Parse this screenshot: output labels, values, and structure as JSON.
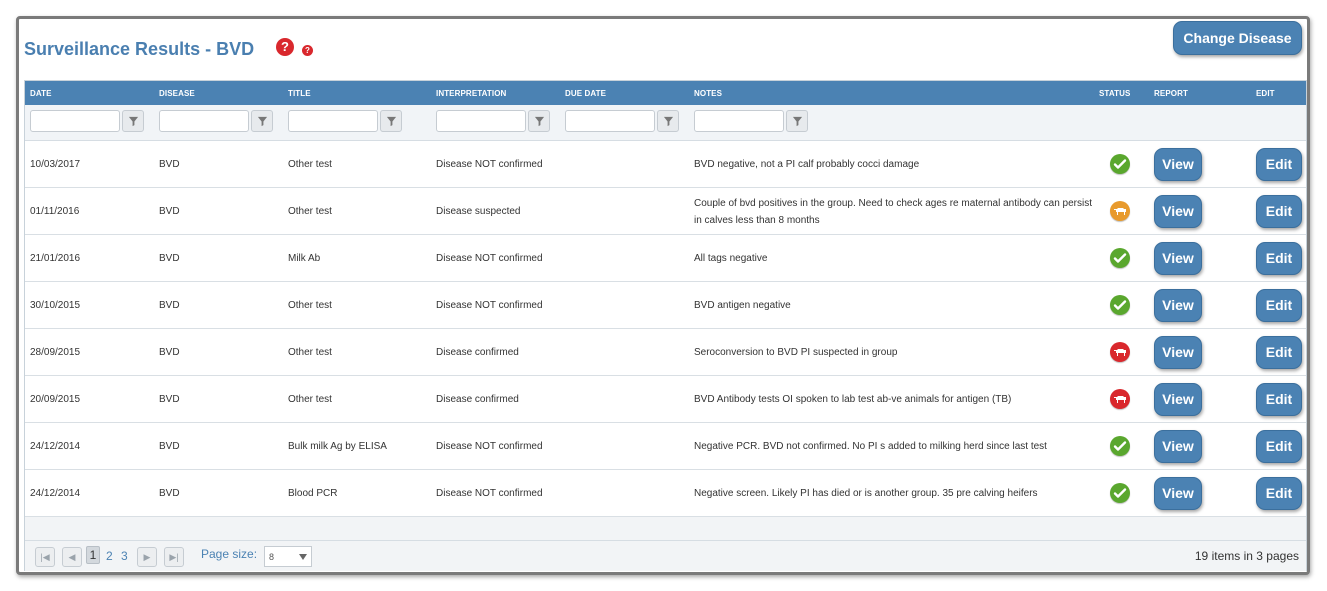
{
  "page": {
    "title": "Surveillance Results - BVD",
    "help_glyph": "?",
    "change_button": "Change Disease"
  },
  "columns": [
    "Date",
    "Disease",
    "Title",
    "Interpretation",
    "Due Date",
    "Notes",
    "Status",
    "Report",
    "Edit"
  ],
  "colors": {
    "header_bg": "#4b82b3",
    "button_bg": "#4b82b3",
    "status_ok": "#5aa72e",
    "status_suspected": "#e89a2c",
    "status_confirmed": "#d9282d"
  },
  "rows": [
    {
      "date": "10/03/2017",
      "disease": "BVD",
      "title": "Other test",
      "interpretation": "Disease NOT confirmed",
      "due_date": "",
      "notes": "BVD negative, not a PI calf probably cocci damage",
      "status": "check-icon",
      "view": "View",
      "edit": "Edit"
    },
    {
      "date": "01/11/2016",
      "disease": "BVD",
      "title": "Other test",
      "interpretation": "Disease suspected",
      "due_date": "",
      "notes": "Couple of bvd positives in the group. Need to check ages re maternal antibody can persist in calves less than 8 months",
      "status": "cow-icon-orange",
      "view": "View",
      "edit": "Edit"
    },
    {
      "date": "21/01/2016",
      "disease": "BVD",
      "title": "Milk Ab",
      "interpretation": "Disease NOT confirmed",
      "due_date": "",
      "notes": "All tags negative",
      "status": "check-icon",
      "view": "View",
      "edit": "Edit"
    },
    {
      "date": "30/10/2015",
      "disease": "BVD",
      "title": "Other test",
      "interpretation": "Disease NOT confirmed",
      "due_date": "",
      "notes": "BVD antigen negative",
      "status": "check-icon",
      "view": "View",
      "edit": "Edit"
    },
    {
      "date": "28/09/2015",
      "disease": "BVD",
      "title": "Other test",
      "interpretation": "Disease confirmed",
      "due_date": "",
      "notes": "Seroconversion to BVD PI suspected in group",
      "status": "cow-icon-red",
      "view": "View",
      "edit": "Edit"
    },
    {
      "date": "20/09/2015",
      "disease": "BVD",
      "title": "Other test",
      "interpretation": "Disease confirmed",
      "due_date": "",
      "notes": "BVD Antibody tests OI spoken to lab test ab-ve animals for antigen (TB)",
      "status": "cow-icon-red",
      "view": "View",
      "edit": "Edit"
    },
    {
      "date": "24/12/2014",
      "disease": "BVD",
      "title": "Bulk milk Ag by ELISA",
      "interpretation": "Disease NOT confirmed",
      "due_date": "",
      "notes": "Negative PCR. BVD not confirmed. No PI s added to milking herd since last test",
      "status": "check-icon",
      "view": "View",
      "edit": "Edit"
    },
    {
      "date": "24/12/2014",
      "disease": "BVD",
      "title": "Blood PCR",
      "interpretation": "Disease NOT confirmed",
      "due_date": "",
      "notes": "Negative screen. Likely PI has died or is another group. 35 pre calving heifers",
      "status": "check-icon",
      "view": "View",
      "edit": "Edit"
    }
  ],
  "pager": {
    "pages": [
      "1",
      "2",
      "3"
    ],
    "current_page": "1",
    "page_size_label": "Page size:",
    "page_size": "8",
    "total_items": "19",
    "items_text": "items in",
    "total_pages": "3",
    "pages_text": "pages"
  }
}
